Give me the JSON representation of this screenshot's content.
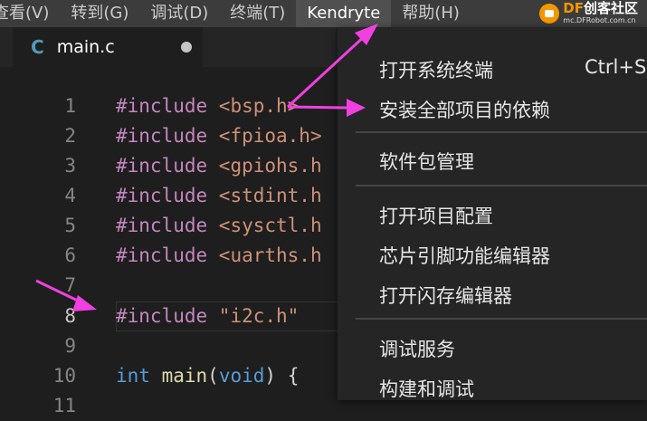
{
  "menubar": {
    "items": [
      "查看(V)",
      "转到(G)",
      "调试(D)",
      "终端(T)",
      "Kendryte",
      "帮助(H)"
    ],
    "behind_text": "main.c"
  },
  "watermark": {
    "brand": "DF",
    "brand_cn": "创客社区",
    "url": "mc.DFRobot.com.cn"
  },
  "tab": {
    "icon_letter": "C",
    "label": "main.c"
  },
  "editor": {
    "line_numbers": [
      "1",
      "2",
      "3",
      "4",
      "5",
      "6",
      "7",
      "8",
      "9",
      "10",
      "11"
    ],
    "current_line": "8",
    "code": {
      "l1a": "#include ",
      "l1b": "<bsp.h>",
      "l2a": "#include ",
      "l2b": "<fpioa.h>",
      "l3a": "#include ",
      "l3b": "<gpiohs.h",
      "l4a": "#include ",
      "l4b": "<stdint.h",
      "l5a": "#include ",
      "l5b": "<sysctl.h",
      "l6a": "#include ",
      "l6b": "<uarths.h",
      "l8a": "#include ",
      "l8b": "\"i2c.h\"",
      "l10a": "int",
      "l10b": " ",
      "l10c": "main",
      "l10d": "(",
      "l10e": "void",
      "l10f": ") {"
    }
  },
  "dropdown": {
    "open_system_terminal": "打开系统终端",
    "open_system_terminal_shortcut": "Ctrl+Sh",
    "install_all_dependencies": "安装全部项目的依赖",
    "package_manager": "软件包管理",
    "project_config": "打开项目配置",
    "pin_function_editor": "芯片引脚功能编辑器",
    "flash_editor": "打开闪存编辑器",
    "debug_server": "调试服务",
    "build_and_debug": "构建和调试"
  },
  "colors": {
    "arrow": "#f040e0",
    "menu_active": "#505050",
    "brand_orange": "#f39800"
  }
}
